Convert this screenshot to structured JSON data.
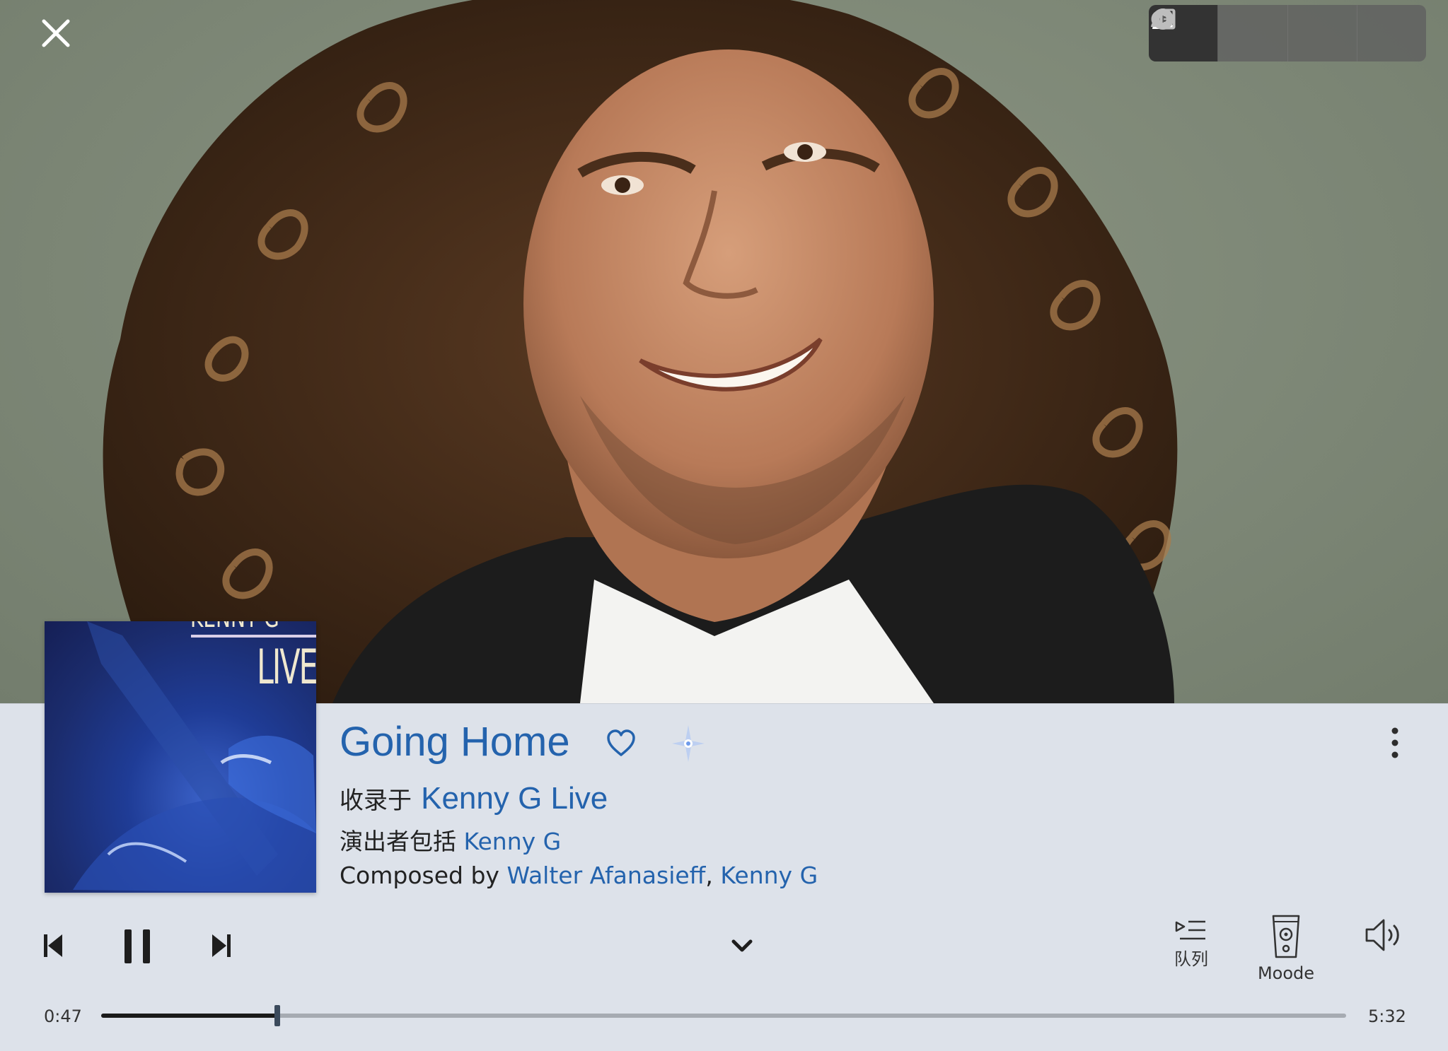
{
  "track": {
    "title": "Going Home",
    "album_prefix": "收录于",
    "album": "Kenny G Live",
    "performers_prefix": "演出者包括",
    "performers": "Kenny G",
    "composers_prefix": "Composed by",
    "composer_1": "Walter Afanasieff",
    "composer_sep": ",",
    "composer_2": "Kenny G"
  },
  "album_art": {
    "top_text": "KENNY G",
    "title_text": "LIVE"
  },
  "controls": {
    "queue_label": "队列",
    "output_label": "Moode"
  },
  "playback": {
    "elapsed": "0:47",
    "total": "5:32",
    "progress_fraction": 0.1416,
    "state": "playing"
  },
  "view_toggle": {
    "segments": [
      "artist-icon",
      "disc-icon",
      "album-info-icon",
      "artist-info-icon"
    ],
    "active_index": 0
  },
  "colors": {
    "accent": "#2463ad",
    "panel": "#dde2ea",
    "toggle_active": "#333333"
  }
}
